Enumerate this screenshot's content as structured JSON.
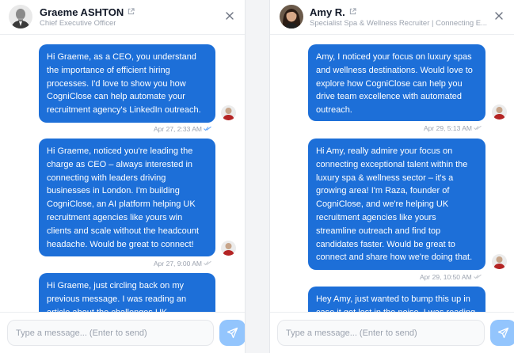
{
  "conversations": [
    {
      "contact": {
        "name": "Graeme ASHTON",
        "subtitle": "Chief Executive Officer"
      },
      "messages": [
        {
          "text": "Hi Graeme, as a CEO, you understand the importance of efficient hiring processes. I'd love to show you how CogniClose can help automate your recruitment agency's LinkedIn outreach.",
          "timestamp": "Apr 27, 2:33 AM"
        },
        {
          "text": "Hi Graeme, noticed you're leading the charge as CEO – always interested in connecting with leaders driving businesses in London. I'm building CogniClose, an AI platform helping UK recruitment agencies like yours win clients and scale without the headcount headache. Would be great to connect!",
          "timestamp": "Apr 27, 9:00 AM"
        },
        {
          "text": "Hi Graeme, just circling back on my previous message. I was reading an article about the challenges UK",
          "timestamp": ""
        }
      ],
      "composer": {
        "placeholder": "Type a message... (Enter to send)"
      }
    },
    {
      "contact": {
        "name": "Amy R.",
        "subtitle": "Specialist Spa & Wellness Recruiter | Connecting E..."
      },
      "messages": [
        {
          "text": "Amy, I noticed your focus on luxury spas and wellness destinations. Would love to explore how CogniClose can help you drive team excellence with automated outreach.",
          "timestamp": "Apr 29, 5:13 AM"
        },
        {
          "text": "Hi Amy, really admire your focus on connecting exceptional talent within the luxury spa & wellness sector – it's a growing area! I'm Raza, founder of CogniClose, and we're helping UK recruitment agencies like yours streamline outreach and find top candidates faster. Would be great to connect and share how we're doing that.",
          "timestamp": "Apr 29, 10:50 AM"
        },
        {
          "text": "Hey Amy, just wanted to bump this up in case it got lost in the noise. I was reading",
          "timestamp": ""
        }
      ],
      "composer": {
        "placeholder": "Type a message... (Enter to send)"
      }
    }
  ],
  "icons": {
    "external_link": "external-link-icon",
    "close": "close-icon",
    "read_receipt": "double-check-icon",
    "send": "send-icon"
  },
  "colors": {
    "bubble": "#1d6fd8",
    "send_button": "#93c5fd",
    "muted_text": "#9ca3af"
  }
}
